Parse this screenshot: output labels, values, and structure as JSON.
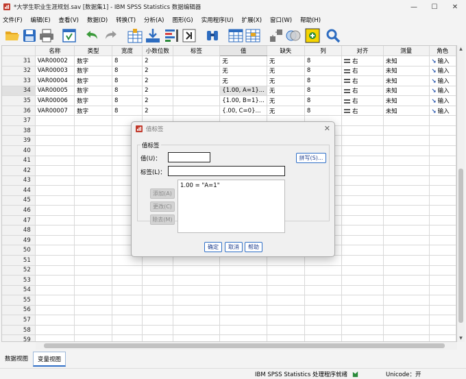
{
  "window": {
    "title": "*大学生职业生涯规划.sav [数据集1] - IBM SPSS Statistics 数据编辑器",
    "minimize": "—",
    "maximize": "☐",
    "close": "✕"
  },
  "menu": [
    "文件(F)",
    "编辑(E)",
    "查看(V)",
    "数据(D)",
    "转换(T)",
    "分析(A)",
    "图形(G)",
    "实用程序(U)",
    "扩展(X)",
    "窗口(W)",
    "帮助(H)"
  ],
  "toolbar": [
    "open-icon",
    "save-icon",
    "print-icon",
    "recall-dialog-icon",
    "undo-icon",
    "redo-icon",
    "goto-case-icon",
    "goto-variable-icon",
    "variables-icon",
    "run-descriptives-icon",
    "find-icon",
    "split-file-icon",
    "select-cases-icon",
    "value-labels-icon",
    "use-variable-sets-icon",
    "show-all-variables-icon",
    "spelling-icon"
  ],
  "grid": {
    "columns": [
      "名称",
      "类型",
      "宽度",
      "小数位数",
      "标签",
      "值",
      "缺失",
      "列",
      "对齐",
      "测量",
      "角色"
    ],
    "rows": [
      {
        "num": "31",
        "name": "VAR00002",
        "type": "数字",
        "width": "8",
        "dec": "2",
        "label": "",
        "values": "无",
        "missing": "无",
        "cols": "8",
        "align": "右",
        "measure": "未知",
        "role": "输入"
      },
      {
        "num": "32",
        "name": "VAR00003",
        "type": "数字",
        "width": "8",
        "dec": "2",
        "label": "",
        "values": "无",
        "missing": "无",
        "cols": "8",
        "align": "右",
        "measure": "未知",
        "role": "输入"
      },
      {
        "num": "33",
        "name": "VAR00004",
        "type": "数字",
        "width": "8",
        "dec": "2",
        "label": "",
        "values": "无",
        "missing": "无",
        "cols": "8",
        "align": "右",
        "measure": "未知",
        "role": "输入"
      },
      {
        "num": "34",
        "name": "VAR00005",
        "type": "数字",
        "width": "8",
        "dec": "2",
        "label": "",
        "values": "{1.00, A=1}...",
        "missing": "无",
        "cols": "8",
        "align": "右",
        "measure": "未知",
        "role": "输入"
      },
      {
        "num": "35",
        "name": "VAR00006",
        "type": "数字",
        "width": "8",
        "dec": "2",
        "label": "",
        "values": "{1.00, B=1}...",
        "missing": "无",
        "cols": "8",
        "align": "右",
        "measure": "未知",
        "role": "输入"
      },
      {
        "num": "36",
        "name": "VAR00007",
        "type": "数字",
        "width": "8",
        "dec": "2",
        "label": "",
        "values": "{.00, C=0}...",
        "missing": "无",
        "cols": "8",
        "align": "右",
        "measure": "未知",
        "role": "输入"
      }
    ],
    "empty_rows": [
      "37",
      "38",
      "39",
      "40",
      "41",
      "42",
      "43",
      "44",
      "45",
      "46",
      "47",
      "48",
      "49",
      "50",
      "51",
      "52",
      "53",
      "54",
      "55",
      "56",
      "57",
      "58",
      "59"
    ]
  },
  "tabs": {
    "data_view": "数据视图",
    "variable_view": "变量视图"
  },
  "status": {
    "processor": "IBM SPSS Statistics 处理程序就绪",
    "unicode": "Unicode：开"
  },
  "dialog": {
    "title": "值标签",
    "group_label": "值标签",
    "value_label": "值(U)：",
    "value_input": "",
    "label_label": "标签(L)：",
    "label_input": "",
    "list_items": [
      "1.00 = \"A=1\""
    ],
    "add": "添加(A)",
    "change": "更改(C)",
    "remove": "除去(M)",
    "spelling": "拼写(S)...",
    "ok": "确定",
    "cancel": "取消",
    "help": "帮助"
  }
}
